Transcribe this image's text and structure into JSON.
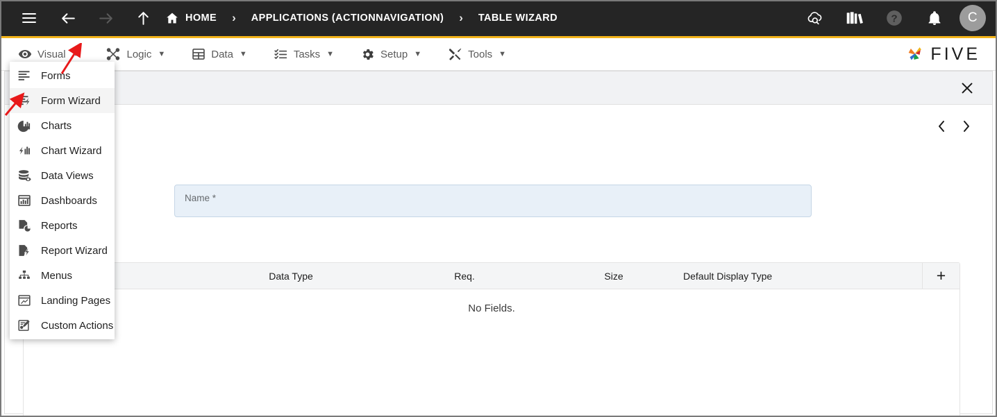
{
  "topbar": {
    "menu_icon": "hamburger-icon",
    "back_icon": "arrow-left-icon",
    "forward_icon": "arrow-right-icon",
    "up_icon": "arrow-up-icon",
    "home_icon": "home-icon",
    "breadcrumbs": [
      {
        "label": "HOME"
      },
      {
        "label": "APPLICATIONS (ACTIONNAVIGATION)"
      },
      {
        "label": "TABLE WIZARD"
      }
    ],
    "separator": "›",
    "actions": [
      {
        "name": "cloud-search-icon"
      },
      {
        "name": "library-books-icon"
      },
      {
        "name": "help-icon"
      },
      {
        "name": "notifications-bell-icon"
      }
    ],
    "avatar_initial": "C",
    "accent_color": "#f2b31a",
    "background_color": "#252525"
  },
  "menubar": {
    "items": [
      {
        "label": "Visual",
        "icon": "eye-icon",
        "caret": "▼"
      },
      {
        "label": "Logic",
        "icon": "logic-nodes-icon",
        "caret": "▼"
      },
      {
        "label": "Data",
        "icon": "table-grid-icon",
        "caret": "▼"
      },
      {
        "label": "Tasks",
        "icon": "task-list-icon",
        "caret": "▼"
      },
      {
        "label": "Setup",
        "icon": "gear-icon",
        "caret": "▼"
      },
      {
        "label": "Tools",
        "icon": "tools-icon",
        "caret": "▼"
      }
    ],
    "logo_text": "FIVE"
  },
  "visual_menu": {
    "open": true,
    "items": [
      {
        "label": "Forms",
        "icon": "forms-icon",
        "active": false
      },
      {
        "label": "Form Wizard",
        "icon": "form-wizard-icon",
        "active": true
      },
      {
        "label": "Charts",
        "icon": "charts-pie-icon",
        "active": false
      },
      {
        "label": "Chart Wizard",
        "icon": "chart-wizard-icon",
        "active": false
      },
      {
        "label": "Data Views",
        "icon": "data-views-icon",
        "active": false
      },
      {
        "label": "Dashboards",
        "icon": "dashboards-icon",
        "active": false
      },
      {
        "label": "Reports",
        "icon": "reports-icon",
        "active": false
      },
      {
        "label": "Report Wizard",
        "icon": "report-wizard-icon",
        "active": false
      },
      {
        "label": "Menus",
        "icon": "menus-hierarchy-icon",
        "active": false
      },
      {
        "label": "Landing Pages",
        "icon": "landing-pages-icon",
        "active": false
      },
      {
        "label": "Custom Actions",
        "icon": "custom-actions-icon",
        "active": false
      }
    ]
  },
  "modal": {
    "close_icon": "close-icon",
    "prev_icon": "chevron-left-icon",
    "next_icon": "chevron-right-icon"
  },
  "form": {
    "name_field": {
      "label": "Name *",
      "value": "",
      "placeholder": ""
    }
  },
  "fields_table": {
    "columns": [
      {
        "key": "name",
        "label": ""
      },
      {
        "key": "data_type",
        "label": "Data Type"
      },
      {
        "key": "req",
        "label": "Req."
      },
      {
        "key": "size",
        "label": "Size"
      },
      {
        "key": "default_display_type",
        "label": "Default Display Type"
      }
    ],
    "add_button_label": "+",
    "rows": [],
    "empty_message": "No Fields."
  },
  "annotations": {
    "arrow_color": "#e8191a",
    "arrows": [
      {
        "name": "arrow-to-visual-menu",
        "target": "Visual dropdown caret"
      },
      {
        "name": "arrow-to-form-wizard",
        "target": "Form Wizard menu item"
      }
    ]
  }
}
